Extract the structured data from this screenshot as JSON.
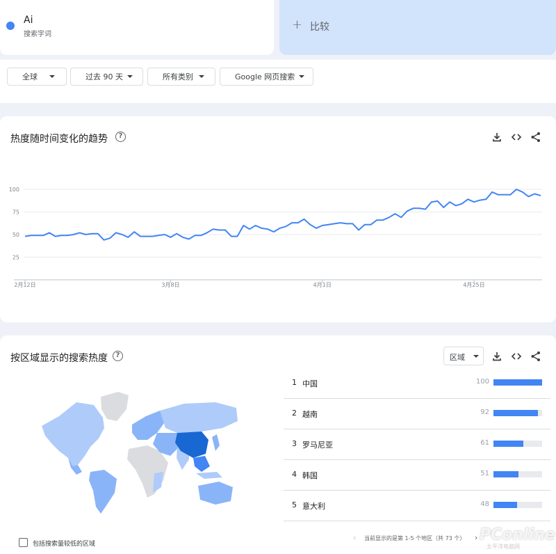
{
  "term": {
    "name": "Ai",
    "subtitle": "搜索字词"
  },
  "compare": {
    "plus": "+",
    "label": "比较"
  },
  "filters": [
    {
      "label": "全球"
    },
    {
      "label": "过去 90 天"
    },
    {
      "label": "所有类别"
    },
    {
      "label": "Google 网页搜索"
    }
  ],
  "trend": {
    "title": "热度随时间变化的趋势",
    "help": "?"
  },
  "chart_data": {
    "type": "line",
    "title": "",
    "xlabel": "",
    "ylabel": "",
    "ylim": [
      0,
      100
    ],
    "yticks": [
      25,
      50,
      75,
      100
    ],
    "xtick_labels": [
      "2月12日",
      "3月8日",
      "4月1日",
      "4月25日"
    ],
    "xtick_index": [
      0,
      24,
      49,
      74
    ],
    "series": [
      {
        "color": "#4285f4",
        "values": [
          48,
          49,
          49,
          49,
          52,
          48,
          49,
          49,
          50,
          52,
          50,
          51,
          51,
          44,
          46,
          52,
          50,
          47,
          53,
          48,
          48,
          48,
          49,
          50,
          47,
          51,
          47,
          45,
          49,
          49,
          52,
          56,
          55,
          55,
          48,
          48,
          60,
          56,
          60,
          57,
          56,
          53,
          57,
          59,
          63,
          63,
          67,
          61,
          57,
          60,
          61,
          62,
          63,
          62,
          62,
          55,
          61,
          61,
          66,
          66,
          69,
          73,
          69,
          76,
          79,
          79,
          78,
          86,
          87,
          80,
          86,
          82,
          84,
          89,
          86,
          88,
          89,
          97,
          94,
          94,
          94,
          100,
          97,
          92,
          95,
          93
        ]
      }
    ]
  },
  "region": {
    "title": "按区域显示的搜索热度",
    "help": "?",
    "select_label": "区域",
    "rows": [
      {
        "rank": "1",
        "name": "中国",
        "value": "100",
        "fraction": 1.0
      },
      {
        "rank": "2",
        "name": "越南",
        "value": "92",
        "fraction": 0.92
      },
      {
        "rank": "3",
        "name": "罗马尼亚",
        "value": "61",
        "fraction": 0.61
      },
      {
        "rank": "4",
        "name": "韩国",
        "value": "51",
        "fraction": 0.51
      },
      {
        "rank": "5",
        "name": "意大利",
        "value": "48",
        "fraction": 0.48
      }
    ],
    "checkbox_label": "包括搜索量较低的区域",
    "pager_text": "当前显示的是第 1-5 个地区（共 73 个）",
    "pager_prev": "‹",
    "pager_next": "›"
  },
  "watermark": {
    "brand": "PConline",
    "sub": "太平洋电脑网"
  },
  "colors": {
    "accent": "#4285f4",
    "compare_bg": "#d2e3fc",
    "map_dark": "#1967d2",
    "map_light": "#aecbfa",
    "map_none": "#dadce0"
  }
}
